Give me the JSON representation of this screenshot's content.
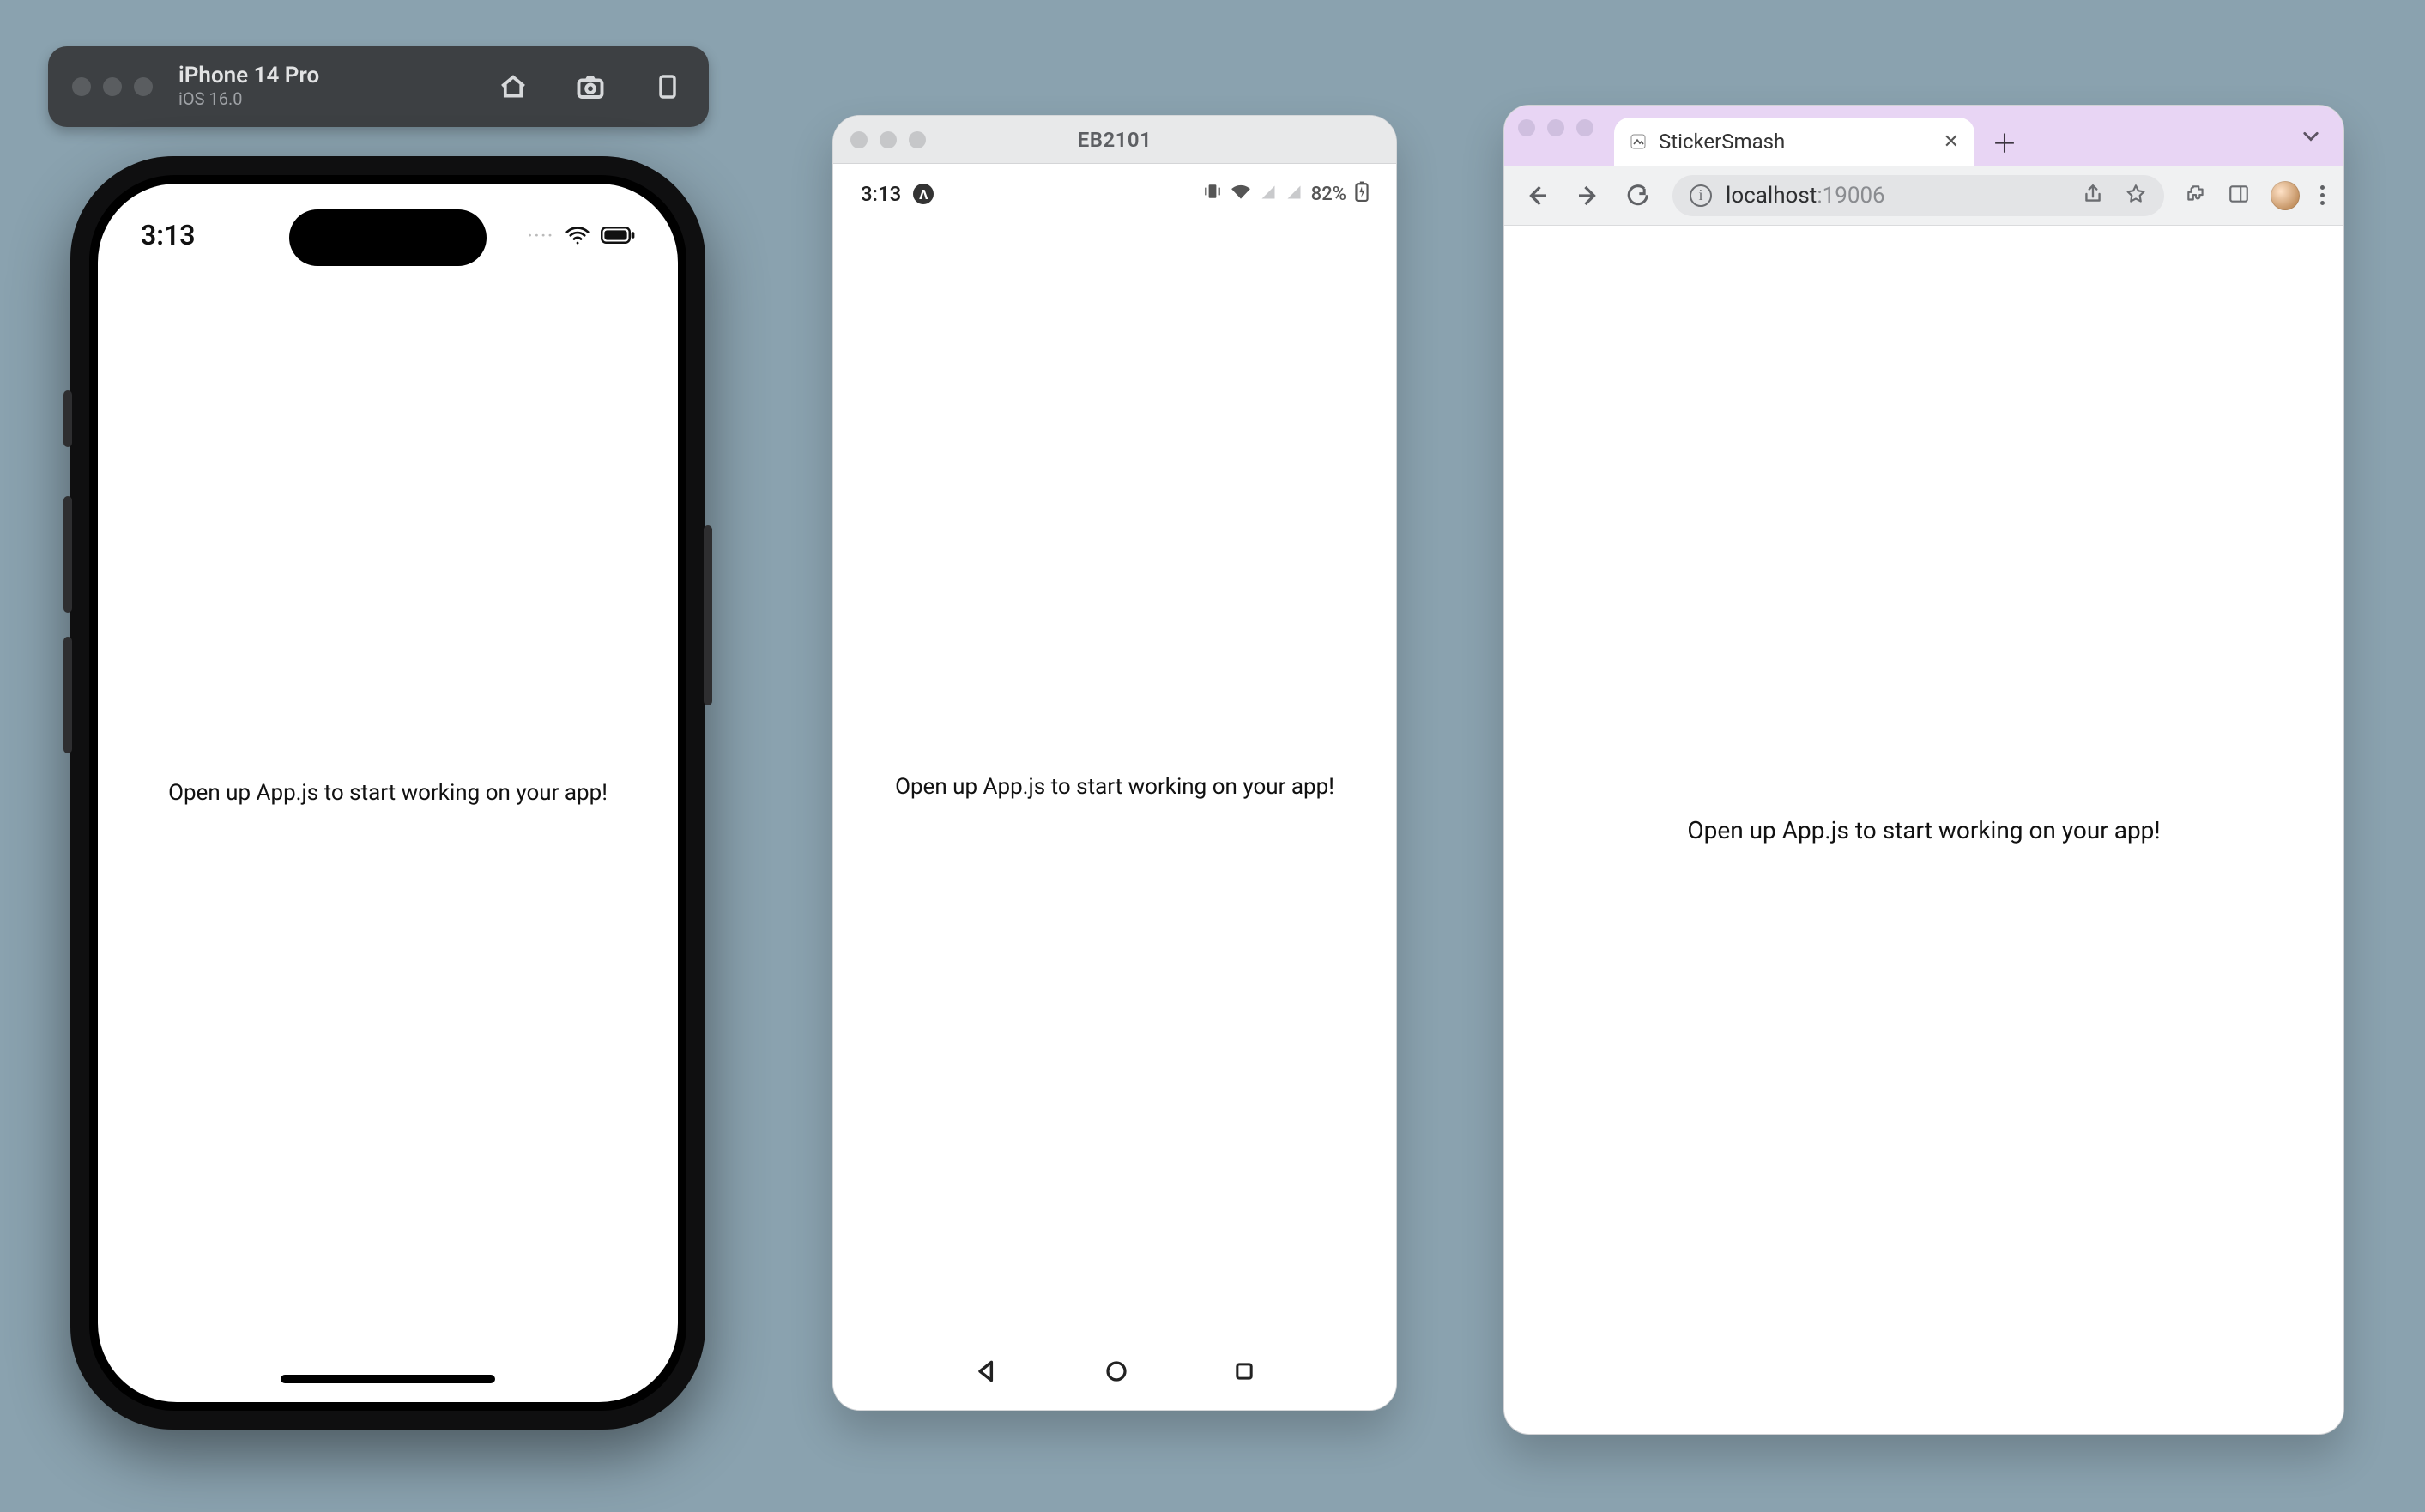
{
  "simulator": {
    "device": "iPhone 14 Pro",
    "os": "iOS 16.0"
  },
  "ios": {
    "clock": "3:13",
    "app_text": "Open up App.js to start working on your app!"
  },
  "android": {
    "window_title": "EB2101",
    "clock": "3:13",
    "expo_initial": "Λ",
    "battery": "82%",
    "app_text": "Open up App.js to start working on your app!"
  },
  "browser": {
    "tab_title": "StickerSmash",
    "url_host": "localhost",
    "url_port": ":19006",
    "app_text": "Open up App.js to start working on your app!"
  }
}
